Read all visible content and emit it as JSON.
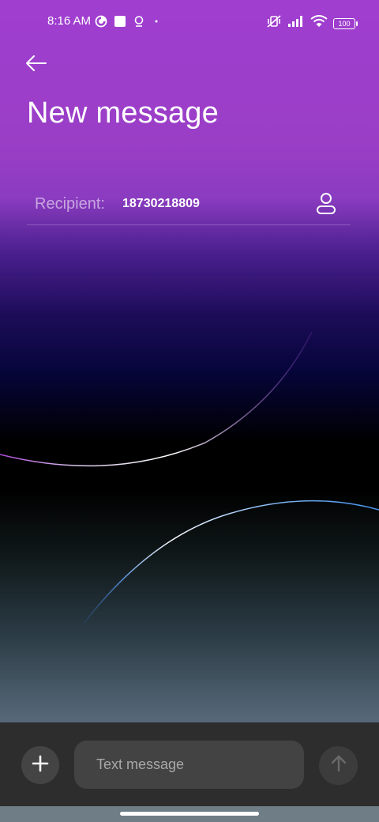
{
  "status_bar": {
    "time": "8:16 AM",
    "battery": "100",
    "left_icons": [
      "data-saver-icon",
      "app-square-icon",
      "location-pin-icon",
      "dot-icon"
    ],
    "right_icons": [
      "mute-vibrate-icon",
      "signal-icon",
      "wifi-icon",
      "battery-icon"
    ]
  },
  "header": {
    "back_icon": "back-arrow-icon",
    "title": "New message"
  },
  "recipient": {
    "label": "Recipient:",
    "value": "18730218809",
    "contact_icon": "contact-person-icon"
  },
  "composer": {
    "add_icon": "plus-icon",
    "placeholder": "Text message",
    "send_icon": "send-arrow-icon"
  },
  "colors": {
    "top_purple": "#a03ed0",
    "composer_bg": "#2d2d2d",
    "input_bg": "#434343"
  }
}
